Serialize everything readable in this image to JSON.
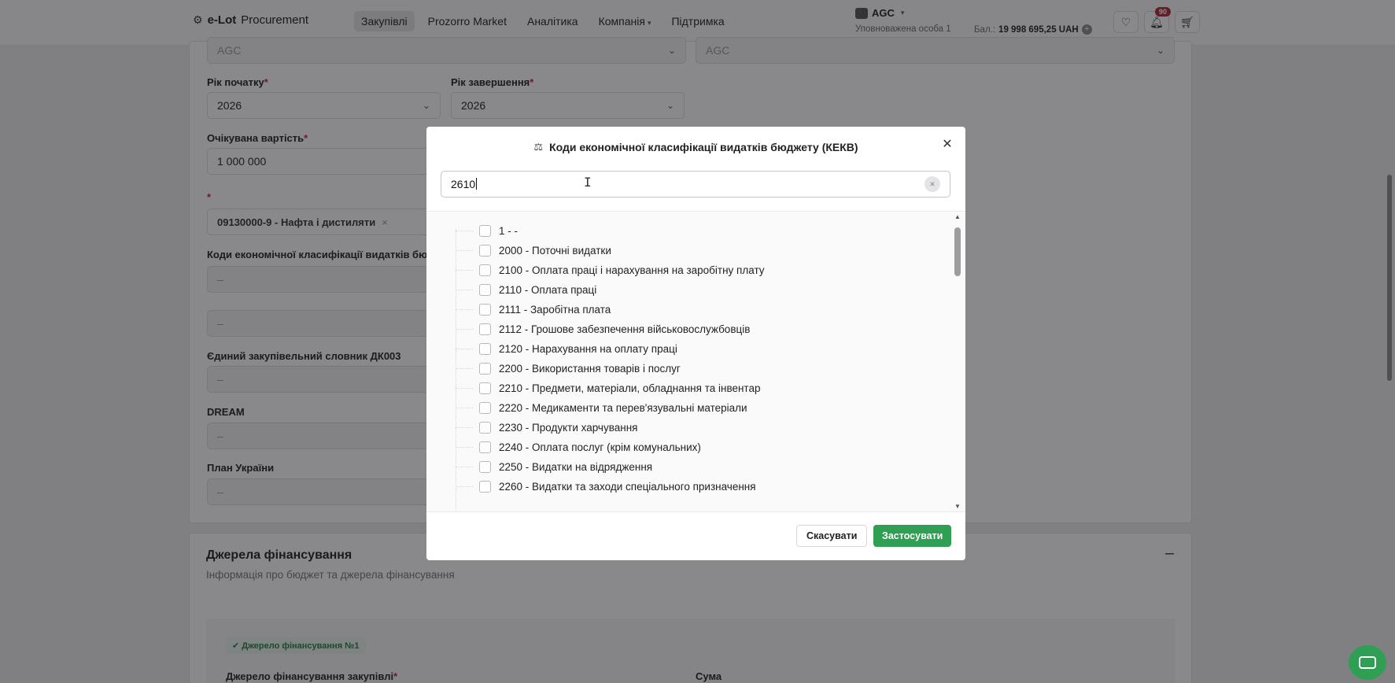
{
  "header": {
    "brand_prefix": "e-Lot",
    "brand_suffix": "Procurement",
    "nav": [
      {
        "label": "Закупівлі"
      },
      {
        "label": "Prozorro Market"
      },
      {
        "label": "Аналітика"
      },
      {
        "label": "Компанія"
      },
      {
        "label": "Підтримка"
      }
    ],
    "org_name": "AGC",
    "auth_person": "Уповноважена особа 1",
    "balance_label": "Бал.:",
    "balance_value": "19 998 695,25 UAH",
    "balance_add": "+",
    "notifications_count": "90"
  },
  "form": {
    "top_left_value": "AGC",
    "top_right_value": "AGC",
    "start_year_label": "Рік початку",
    "start_year_value": "2026",
    "end_year_label": "Рік завершення",
    "end_year_value": "2026",
    "expected_cost_label": "Очікувана вартість",
    "expected_cost_value": "1 000 000",
    "required_mark": "*",
    "cpv_tag": "09130000-9 - Нафта і дистиляти",
    "cpv_tag_remove": "×",
    "kekv_label": "Коди економічної класифікації видатків бюдж",
    "kekv_value": "–",
    "extra_value": "–",
    "dk003_label": "Єдиний закупівельний словник ДК003",
    "dk003_value": "–",
    "dream_label": "DREAM",
    "dream_value": "–",
    "plan_label": "План України",
    "plan_value": "–"
  },
  "funding": {
    "title": "Джерела фінансування",
    "subtitle": "Інформація про бюджет та джерела фінансування",
    "collapse": "–",
    "badge_check": "✔",
    "badge": "Джерело фінансування №1",
    "source_label": "Джерело фінансування закупівлі",
    "source_req": "*",
    "sum_label": "Сума"
  },
  "modal": {
    "title": "Коди економічної класифікації видатків бюджету (КЕКВ)",
    "close": "✕",
    "search_value": "2610",
    "items": [
      {
        "label": "1 - -"
      },
      {
        "label": "2000 - Поточні видатки"
      },
      {
        "label": "2100 - Оплата праці і нарахування на заробітну плату"
      },
      {
        "label": "2110 - Оплата праці"
      },
      {
        "label": "2111 - Заробітна плата"
      },
      {
        "label": "2112 - Грошове забезпечення військовослужбовців"
      },
      {
        "label": "2120 - Нарахування на оплату праці"
      },
      {
        "label": "2200 - Використання товарів і послуг"
      },
      {
        "label": "2210 - Предмети, матеріали, обладнання та інвентар"
      },
      {
        "label": "2220 - Медикаменти та перев'язувальні матеріали"
      },
      {
        "label": "2230 - Продукти харчування"
      },
      {
        "label": "2240 - Оплата послуг (крім комунальних)"
      },
      {
        "label": "2250 - Видатки на відрядження"
      },
      {
        "label": "2260 - Видатки та заходи спеціального призначення"
      }
    ],
    "cancel_label": "Скасувати",
    "apply_label": "Застосувати"
  },
  "colors": {
    "accent_green": "#2e9f53",
    "notif_badge": "#b3263a"
  }
}
